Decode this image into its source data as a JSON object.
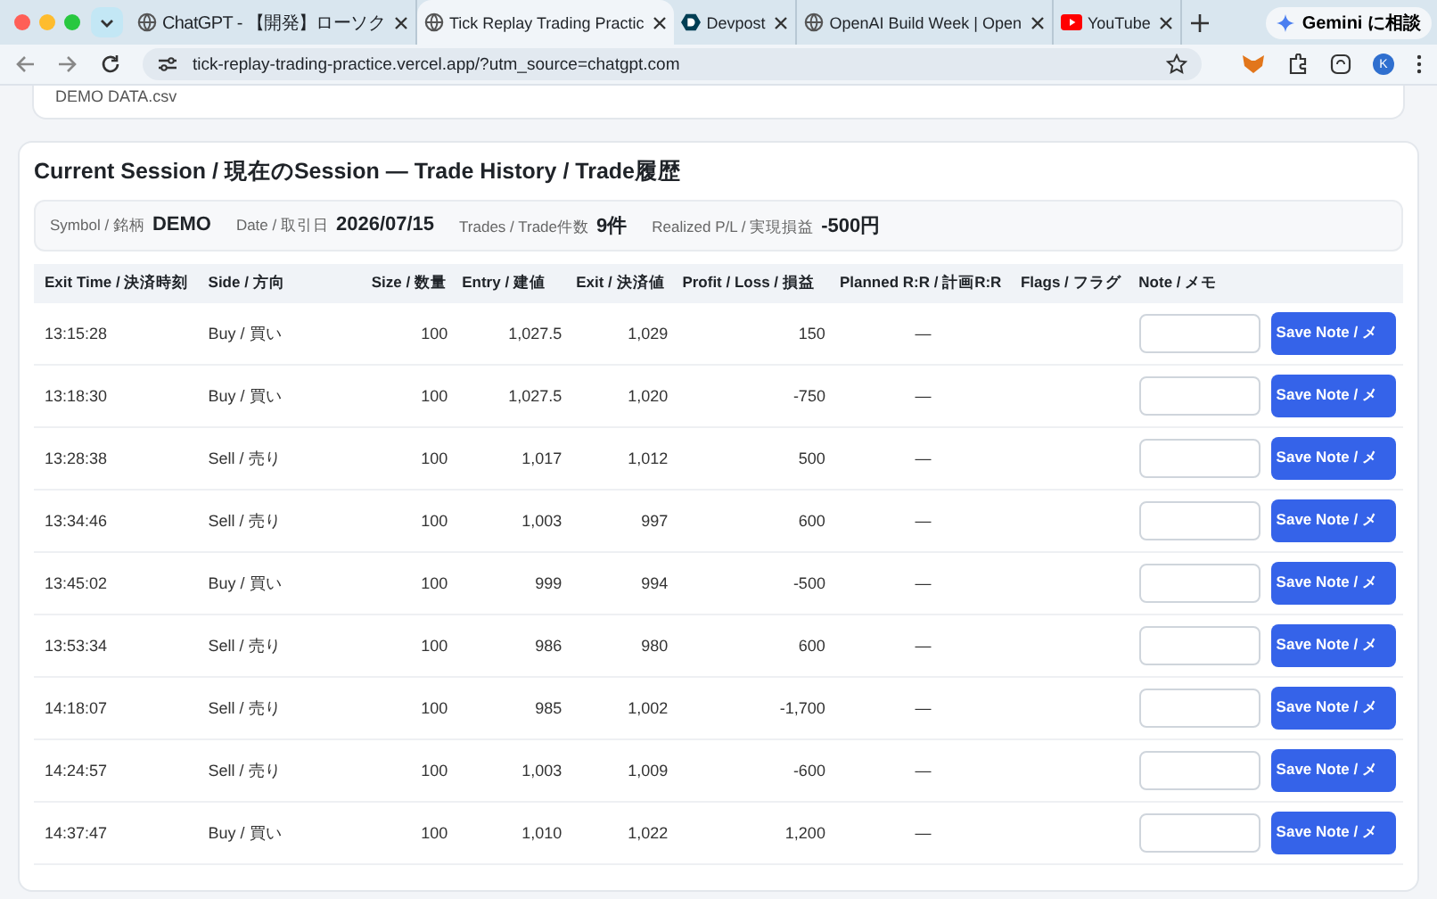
{
  "browser": {
    "tabs": [
      {
        "title": "ChatGPT - 【開発】ローソク",
        "selected": false
      },
      {
        "title": "Tick Replay Trading Practic",
        "selected": true
      },
      {
        "title": "Devpost",
        "selected": false
      },
      {
        "title": "OpenAI Build Week | Open",
        "selected": false
      },
      {
        "title": "YouTube",
        "selected": false
      }
    ],
    "gemini": "Gemini に相談",
    "url": "tick-replay-trading-practice.vercel.app/?utm_source=chatgpt.com",
    "profile": "K"
  },
  "file_card": {
    "name": "DEMO DATA.csv"
  },
  "session": {
    "title": "Current Session / 現在のSession — Trade History / Trade履歴",
    "summary": [
      {
        "label": "Symbol / 銘柄",
        "value": "DEMO"
      },
      {
        "label": "Date / 取引日",
        "value": "2026/07/15"
      },
      {
        "label": "Trades / Trade件数",
        "value": "9件"
      },
      {
        "label": "Realized P/L / 実現損益",
        "value": "-500円"
      }
    ],
    "columns": [
      "Exit Time / 決済時刻",
      "Side / 方向",
      "Size / 数量",
      "Entry / 建値",
      "Exit / 決済値",
      "Profit / Loss / 損益",
      "Planned R:R / 計画R:R",
      "Flags / フラグ",
      "Note / メモ"
    ],
    "rows": [
      {
        "time": "13:15:28",
        "side": "Buy / 買い",
        "size": "100",
        "entry": "1,027.5",
        "exit": "1,029",
        "pl": "150",
        "rr": "—",
        "save": "Save Note / メ"
      },
      {
        "time": "13:18:30",
        "side": "Buy / 買い",
        "size": "100",
        "entry": "1,027.5",
        "exit": "1,020",
        "pl": "-750",
        "rr": "—",
        "save": "Save Note / メ"
      },
      {
        "time": "13:28:38",
        "side": "Sell / 売り",
        "size": "100",
        "entry": "1,017",
        "exit": "1,012",
        "pl": "500",
        "rr": "—",
        "save": "Save Note / メ"
      },
      {
        "time": "13:34:46",
        "side": "Sell / 売り",
        "size": "100",
        "entry": "1,003",
        "exit": "997",
        "pl": "600",
        "rr": "—",
        "save": "Save Note / メ"
      },
      {
        "time": "13:45:02",
        "side": "Buy / 買い",
        "size": "100",
        "entry": "999",
        "exit": "994",
        "pl": "-500",
        "rr": "—",
        "save": "Save Note / メ"
      },
      {
        "time": "13:53:34",
        "side": "Sell / 売り",
        "size": "100",
        "entry": "986",
        "exit": "980",
        "pl": "600",
        "rr": "—",
        "save": "Save Note / メ"
      },
      {
        "time": "14:18:07",
        "side": "Sell / 売り",
        "size": "100",
        "entry": "985",
        "exit": "1,002",
        "pl": "-1,700",
        "rr": "—",
        "save": "Save Note / メ"
      },
      {
        "time": "14:24:57",
        "side": "Sell / 売り",
        "size": "100",
        "entry": "1,003",
        "exit": "1,009",
        "pl": "-600",
        "rr": "—",
        "save": "Save Note / メ"
      },
      {
        "time": "14:37:47",
        "side": "Buy / 買い",
        "size": "100",
        "entry": "1,010",
        "exit": "1,022",
        "pl": "1,200",
        "rr": "—",
        "save": "Save Note / メ"
      }
    ]
  }
}
